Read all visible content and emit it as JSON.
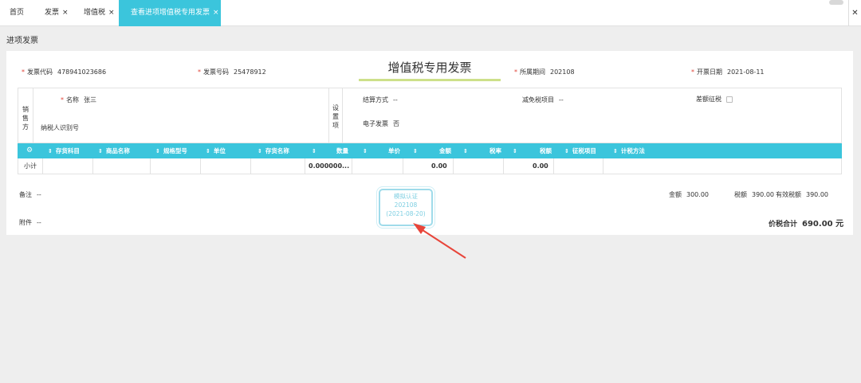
{
  "tabs": [
    {
      "label": "首页",
      "closable": false
    },
    {
      "label": "发票",
      "closable": true
    },
    {
      "label": "增值税",
      "closable": true
    },
    {
      "label": "查看进项增值税专用发票",
      "closable": true,
      "active": true
    }
  ],
  "tab_close_glyph": "×",
  "close_all_glyph": "✕",
  "page_title": "进项发票",
  "header": {
    "invoice_code_label": "发票代码",
    "invoice_code": "478941023686",
    "invoice_number_label": "发票号码",
    "invoice_number": "25478912",
    "doc_title": "增值税专用发票",
    "period_label": "所属期间",
    "period": "202108",
    "date_label": "开票日期",
    "date": "2021-08-11"
  },
  "seller": {
    "side_label": [
      "销",
      "售",
      "方"
    ],
    "name_label": "名称",
    "name": "张三",
    "tax_id_label": "纳税人识别号",
    "settings_label": [
      "设",
      "置",
      "项"
    ],
    "settle_label": "结算方式",
    "settle_value": "--",
    "exempt_label": "减免税项目",
    "exempt_value": "--",
    "diff_tax_label": "差额征税",
    "einvoice_label": "电子发票",
    "einvoice_value": "否"
  },
  "table": {
    "settings_icon": "⚙",
    "sort_icon": "⇕",
    "columns": [
      "存货科目",
      "商品名称",
      "规格型号",
      "单位",
      "存货名称",
      "数量",
      "单价",
      "金额",
      "税率",
      "税额",
      "征税项目",
      "计税方法"
    ],
    "subtotal_label": "小计",
    "subtotal_quantity": "0.000000...",
    "subtotal_amount": "0.00",
    "subtotal_tax": "0.00"
  },
  "remarks_label": "备注",
  "remarks_value": "--",
  "attachment_label": "附件",
  "attachment_value": "--",
  "stamp": {
    "line1": "模拟认证",
    "line2": "202108",
    "line3": "(2021-08-20)"
  },
  "summary": {
    "amount_label": "金额",
    "amount": "300.00",
    "tax_label": "税额",
    "tax": "390.00",
    "valid_tax_label": "有效税额",
    "valid_tax": "390.00",
    "total_label": "价税合计",
    "total": "690.00 元"
  },
  "colors": {
    "accent": "#3bc5dc",
    "required": "#e0453a",
    "arrow": "#e8453a",
    "title_underline": "#cde08a"
  }
}
